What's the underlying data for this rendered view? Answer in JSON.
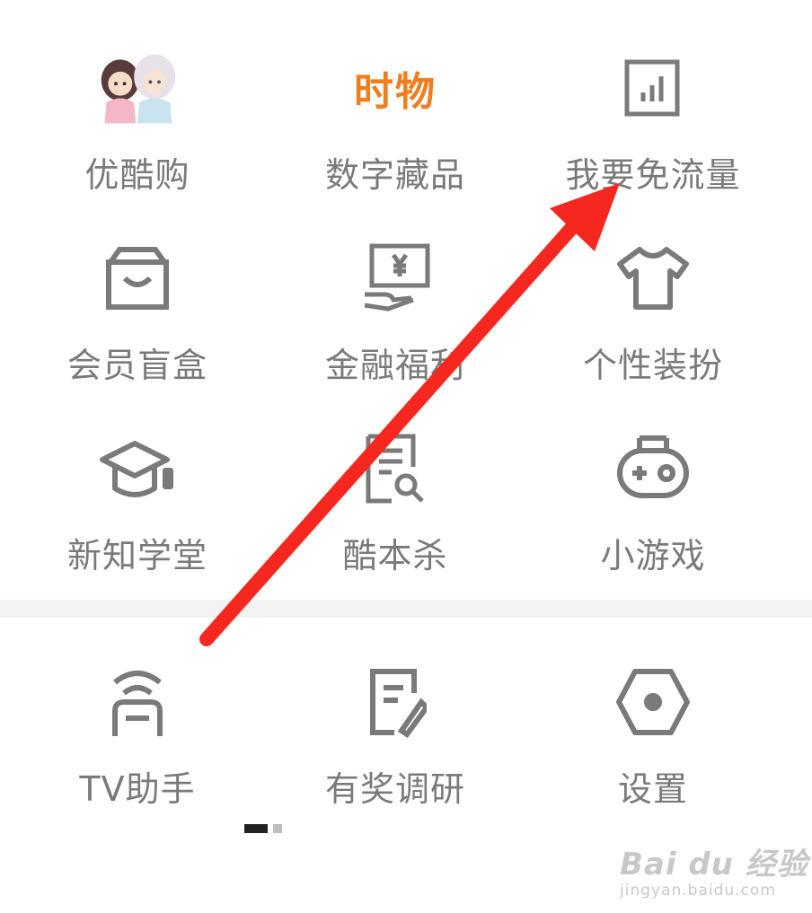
{
  "grid": {
    "row1": [
      {
        "label": "优酷购",
        "icon": "characters-avatar-icon"
      },
      {
        "label": "数字藏品",
        "icon": "digital-collection-logo-icon",
        "logo_text": "时物"
      },
      {
        "label": "我要免流量",
        "icon": "data-bars-icon"
      }
    ],
    "row2": [
      {
        "label": "会员盲盒",
        "icon": "mystery-box-icon"
      },
      {
        "label": "金融福利",
        "icon": "finance-screen-icon"
      },
      {
        "label": "个性装扮",
        "icon": "tshirt-icon"
      }
    ],
    "row3": [
      {
        "label": "新知学堂",
        "icon": "graduation-cap-icon"
      },
      {
        "label": "酷本杀",
        "icon": "script-search-icon"
      },
      {
        "label": "小游戏",
        "icon": "gamepad-icon"
      }
    ],
    "row4": [
      {
        "label": "TV助手",
        "icon": "tv-cast-icon"
      },
      {
        "label": "有奖调研",
        "icon": "survey-edit-icon"
      },
      {
        "label": "设置",
        "icon": "hexagon-settings-icon"
      }
    ]
  },
  "pager": {
    "pages": 2,
    "current": 1
  },
  "watermark": {
    "line1": "Bai du 经验",
    "line2": "jingyan.baidu.com"
  },
  "colors": {
    "icon": "#7a7a7a",
    "label": "#7a7a7a",
    "annotation_arrow": "#f5271e",
    "logo_orange": "#f07d1e"
  }
}
